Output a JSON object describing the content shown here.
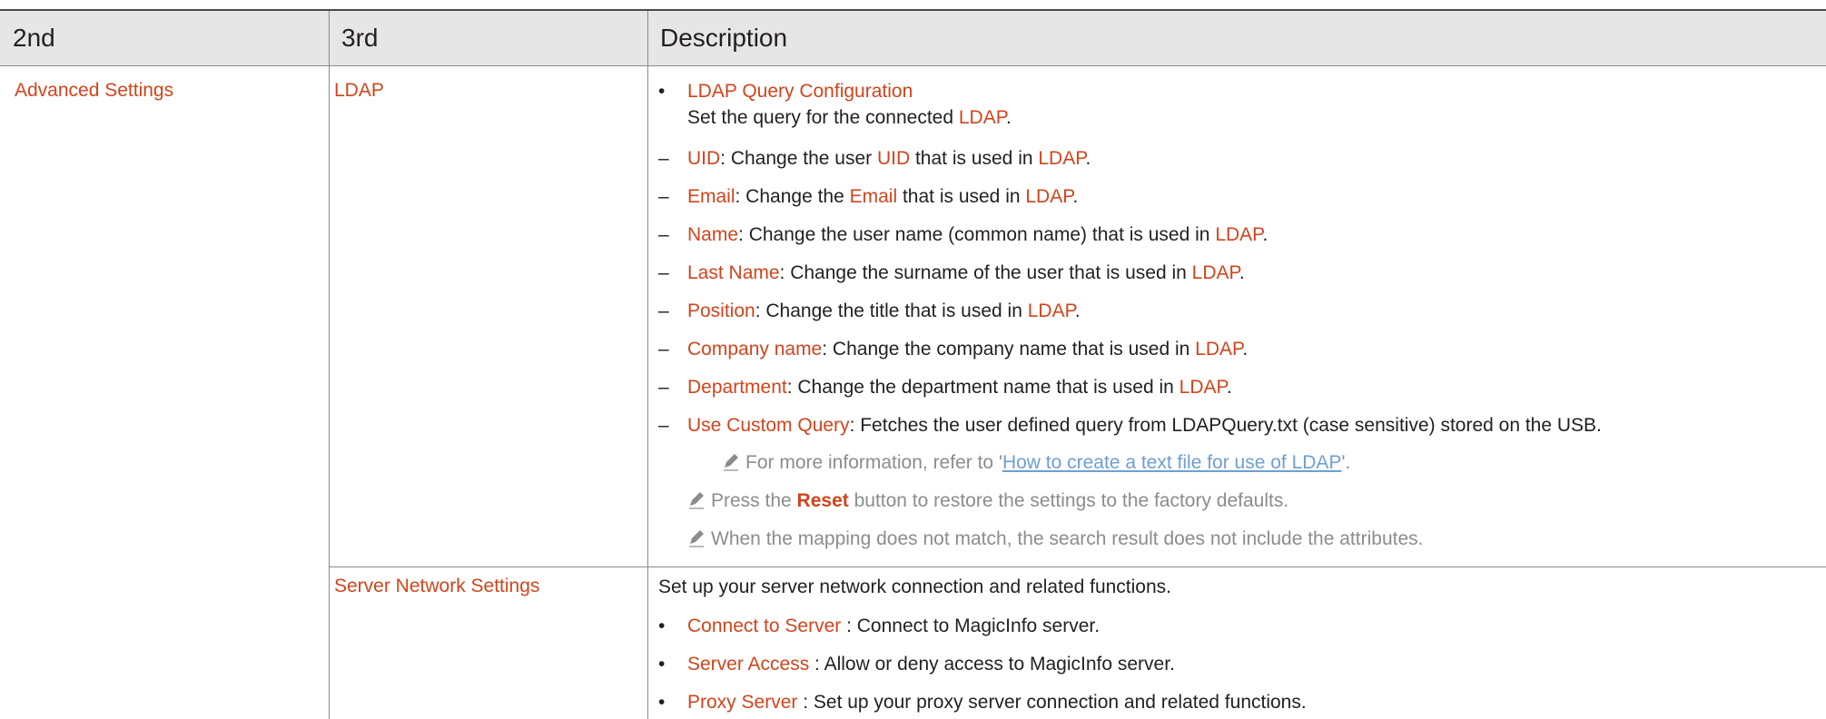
{
  "headers": {
    "col2": "2nd",
    "col3": "3rd",
    "desc": "Description"
  },
  "row1": {
    "col2": "Advanced Settings",
    "col3": "LDAP",
    "bullet_title": "LDAP Query Configuration",
    "bullet_text_a": "Set the query for the connected ",
    "bullet_text_b": "LDAP",
    "bullet_text_c": ".",
    "items": [
      {
        "term": "UID",
        "a": ": Change the user ",
        "b": "UID",
        "c": " that is used in ",
        "d": "LDAP",
        "e": "."
      },
      {
        "term": "Email",
        "a": ": Change the ",
        "b": "Email",
        "c": " that is used in ",
        "d": "LDAP",
        "e": "."
      },
      {
        "term": "Name",
        "a": ": Change the user name (common name) that is used in ",
        "b": "LDAP",
        "c": "."
      },
      {
        "term": "Last Name",
        "a": ": Change the surname of the user that is used in ",
        "b": "LDAP",
        "c": "."
      },
      {
        "term": "Position",
        "a": ": Change the title that is used in ",
        "b": "LDAP",
        "c": "."
      },
      {
        "term": "Company name",
        "a": ": Change the company name that is used in ",
        "b": "LDAP",
        "c": "."
      },
      {
        "term": "Department",
        "a": ": Change the department name that is used in ",
        "b": "LDAP",
        "c": "."
      },
      {
        "term": "Use Custom Query",
        "a": ": Fetches the user defined query from LDAPQuery.txt (case sensitive) stored on the USB."
      }
    ],
    "sub_note_a": "For more information, refer to '",
    "sub_note_link": "How to create a text file for use of LDAP",
    "sub_note_c": "'.",
    "note1_a": "Press the ",
    "note1_b": "Reset",
    "note1_c": " button to restore the settings to the factory defaults.",
    "note2": "When the mapping does not match, the search result does not include the attributes."
  },
  "row2": {
    "col3": "Server Network Settings",
    "intro": "Set up your server network connection and related functions.",
    "bullets": [
      {
        "term": "Connect to Server",
        "text": " : Connect to MagicInfo server."
      },
      {
        "term": "Server Access",
        "text": " : Allow or deny access to MagicInfo server."
      },
      {
        "term": "Proxy Server",
        "text": " : Set up your proxy server connection and related functions."
      }
    ]
  },
  "icons": {
    "bullet": "•",
    "dash": "–",
    "note": "pencil-note-icon"
  },
  "colors": {
    "accent": "#d1441c",
    "note": "#8c8c8c",
    "link": "#6e9fd0",
    "header_bg": "#e6e6e6"
  }
}
